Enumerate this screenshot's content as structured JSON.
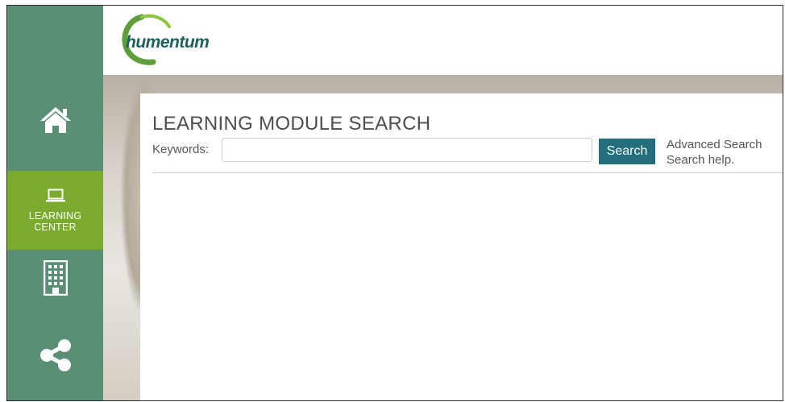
{
  "brand": {
    "logo_text": "humentum"
  },
  "sidebar": {
    "items": [
      {
        "id": "home",
        "icon": "home-icon",
        "label": ""
      },
      {
        "id": "learning",
        "icon": "laptop-icon",
        "label_line1": "LEARNING",
        "label_line2": "CENTER",
        "active": true
      },
      {
        "id": "organization",
        "icon": "building-icon",
        "label": ""
      },
      {
        "id": "share",
        "icon": "share-icon",
        "label": ""
      }
    ],
    "colors": {
      "background": "#5a8f76",
      "active": "#7aab2f"
    }
  },
  "main": {
    "title": "LEARNING MODULE SEARCH",
    "keywords_label": "Keywords:",
    "keywords_value": "",
    "search_button": "Search",
    "advanced_search": "Advanced Search",
    "search_help": "Search help.",
    "colors": {
      "search_button": "#226e7c"
    }
  }
}
